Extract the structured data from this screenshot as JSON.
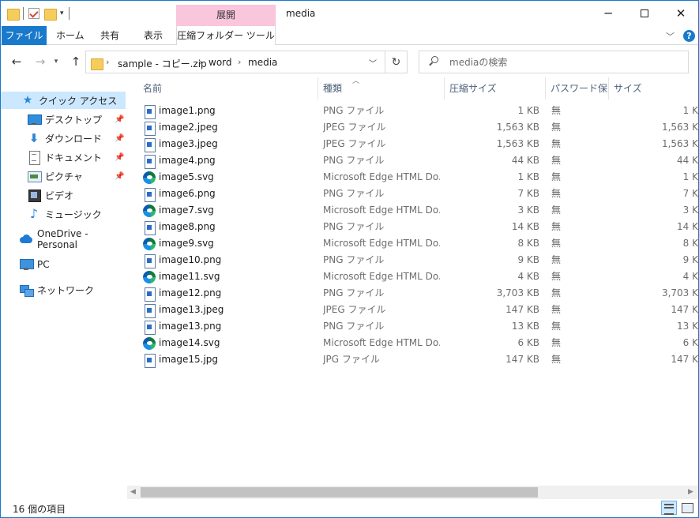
{
  "window": {
    "title": "media"
  },
  "contextual": {
    "group": "展開",
    "tab": "圧縮フォルダー ツール"
  },
  "ribbon": {
    "tabs": [
      {
        "label": "ファイル"
      },
      {
        "label": "ホーム"
      },
      {
        "label": "共有"
      },
      {
        "label": "表示"
      }
    ],
    "help": "?"
  },
  "address": {
    "crumbs": [
      "sample - コピー.zip",
      "word",
      "media"
    ]
  },
  "search": {
    "placeholder": "mediaの検索"
  },
  "sidebar": {
    "items": [
      {
        "label": "クイック アクセス",
        "icon": "star-icon"
      },
      {
        "label": "デスクトップ",
        "icon": "desktop-icon",
        "pinned": true
      },
      {
        "label": "ダウンロード",
        "icon": "download-icon",
        "pinned": true
      },
      {
        "label": "ドキュメント",
        "icon": "documents-icon",
        "pinned": true
      },
      {
        "label": "ピクチャ",
        "icon": "pictures-icon",
        "pinned": true
      },
      {
        "label": "ビデオ",
        "icon": "videos-icon"
      },
      {
        "label": "ミュージック",
        "icon": "music-icon"
      },
      {
        "label": "OneDrive - Personal",
        "icon": "onedrive-icon"
      },
      {
        "label": "PC",
        "icon": "pc-icon"
      },
      {
        "label": "ネットワーク",
        "icon": "network-icon"
      }
    ]
  },
  "columns": {
    "name": "名前",
    "type": "種類",
    "compressed": "圧縮サイズ",
    "password": "パスワード保...",
    "size": "サイズ"
  },
  "files": [
    {
      "name": "image1.png",
      "icon": "image-file-icon",
      "type": "PNG ファイル",
      "compressed": "1 KB",
      "password": "無",
      "size": "1 K"
    },
    {
      "name": "image2.jpeg",
      "icon": "image-file-icon",
      "type": "JPEG ファイル",
      "compressed": "1,563 KB",
      "password": "無",
      "size": "1,563 K"
    },
    {
      "name": "image3.jpeg",
      "icon": "image-file-icon",
      "type": "JPEG ファイル",
      "compressed": "1,563 KB",
      "password": "無",
      "size": "1,563 K"
    },
    {
      "name": "image4.png",
      "icon": "image-file-icon",
      "type": "PNG ファイル",
      "compressed": "44 KB",
      "password": "無",
      "size": "44 K"
    },
    {
      "name": "image5.svg",
      "icon": "edge-icon",
      "type": "Microsoft Edge HTML Do...",
      "compressed": "1 KB",
      "password": "無",
      "size": "1 K"
    },
    {
      "name": "image6.png",
      "icon": "image-file-icon",
      "type": "PNG ファイル",
      "compressed": "7 KB",
      "password": "無",
      "size": "7 K"
    },
    {
      "name": "image7.svg",
      "icon": "edge-icon",
      "type": "Microsoft Edge HTML Do...",
      "compressed": "3 KB",
      "password": "無",
      "size": "3 K"
    },
    {
      "name": "image8.png",
      "icon": "image-file-icon",
      "type": "PNG ファイル",
      "compressed": "14 KB",
      "password": "無",
      "size": "14 K"
    },
    {
      "name": "image9.svg",
      "icon": "edge-icon",
      "type": "Microsoft Edge HTML Do...",
      "compressed": "8 KB",
      "password": "無",
      "size": "8 K"
    },
    {
      "name": "image10.png",
      "icon": "image-file-icon",
      "type": "PNG ファイル",
      "compressed": "9 KB",
      "password": "無",
      "size": "9 K"
    },
    {
      "name": "image11.svg",
      "icon": "edge-icon",
      "type": "Microsoft Edge HTML Do...",
      "compressed": "4 KB",
      "password": "無",
      "size": "4 K"
    },
    {
      "name": "image12.png",
      "icon": "image-file-icon",
      "type": "PNG ファイル",
      "compressed": "3,703 KB",
      "password": "無",
      "size": "3,703 K"
    },
    {
      "name": "image13.jpeg",
      "icon": "image-file-icon",
      "type": "JPEG ファイル",
      "compressed": "147 KB",
      "password": "無",
      "size": "147 K"
    },
    {
      "name": "image13.png",
      "icon": "image-file-icon",
      "type": "PNG ファイル",
      "compressed": "13 KB",
      "password": "無",
      "size": "13 K"
    },
    {
      "name": "image14.svg",
      "icon": "edge-icon",
      "type": "Microsoft Edge HTML Do...",
      "compressed": "6 KB",
      "password": "無",
      "size": "6 K"
    },
    {
      "name": "image15.jpg",
      "icon": "image-file-icon",
      "type": "JPG ファイル",
      "compressed": "147 KB",
      "password": "無",
      "size": "147 K"
    }
  ],
  "status": {
    "item_count": "16 個の項目"
  }
}
